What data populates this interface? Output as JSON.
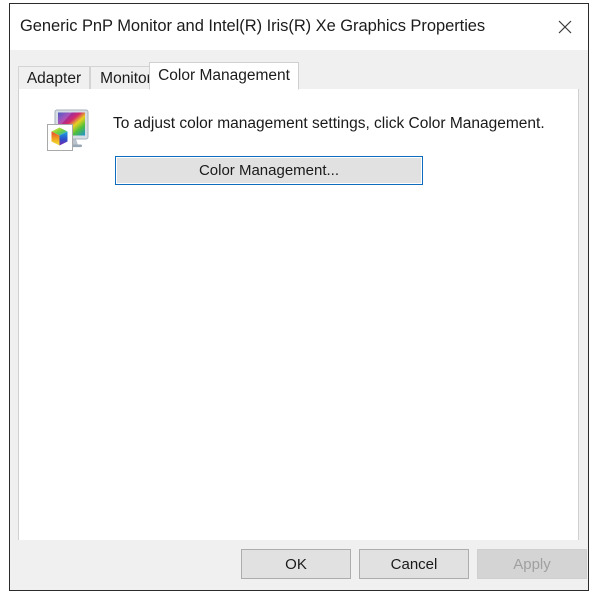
{
  "window": {
    "title": "Generic PnP Monitor and Intel(R) Iris(R) Xe Graphics Properties",
    "close_icon": "close-icon"
  },
  "tabs": [
    {
      "label": "Adapter",
      "selected": false
    },
    {
      "label": "Monitor",
      "selected": false
    },
    {
      "label": "Color Management",
      "selected": true
    }
  ],
  "content": {
    "icon": "color-management-monitor-icon",
    "description": "To adjust color management settings, click Color Management.",
    "action_button": "Color Management..."
  },
  "footer": {
    "ok": "OK",
    "cancel": "Cancel",
    "apply": "Apply"
  },
  "colors": {
    "window_bg": "#f0f0f0",
    "panel_bg": "#ffffff",
    "focus_border": "#0f6cbd",
    "button_face": "#e1e1e1",
    "disabled_text": "#a0a0a0",
    "text": "#1a1a1a"
  }
}
